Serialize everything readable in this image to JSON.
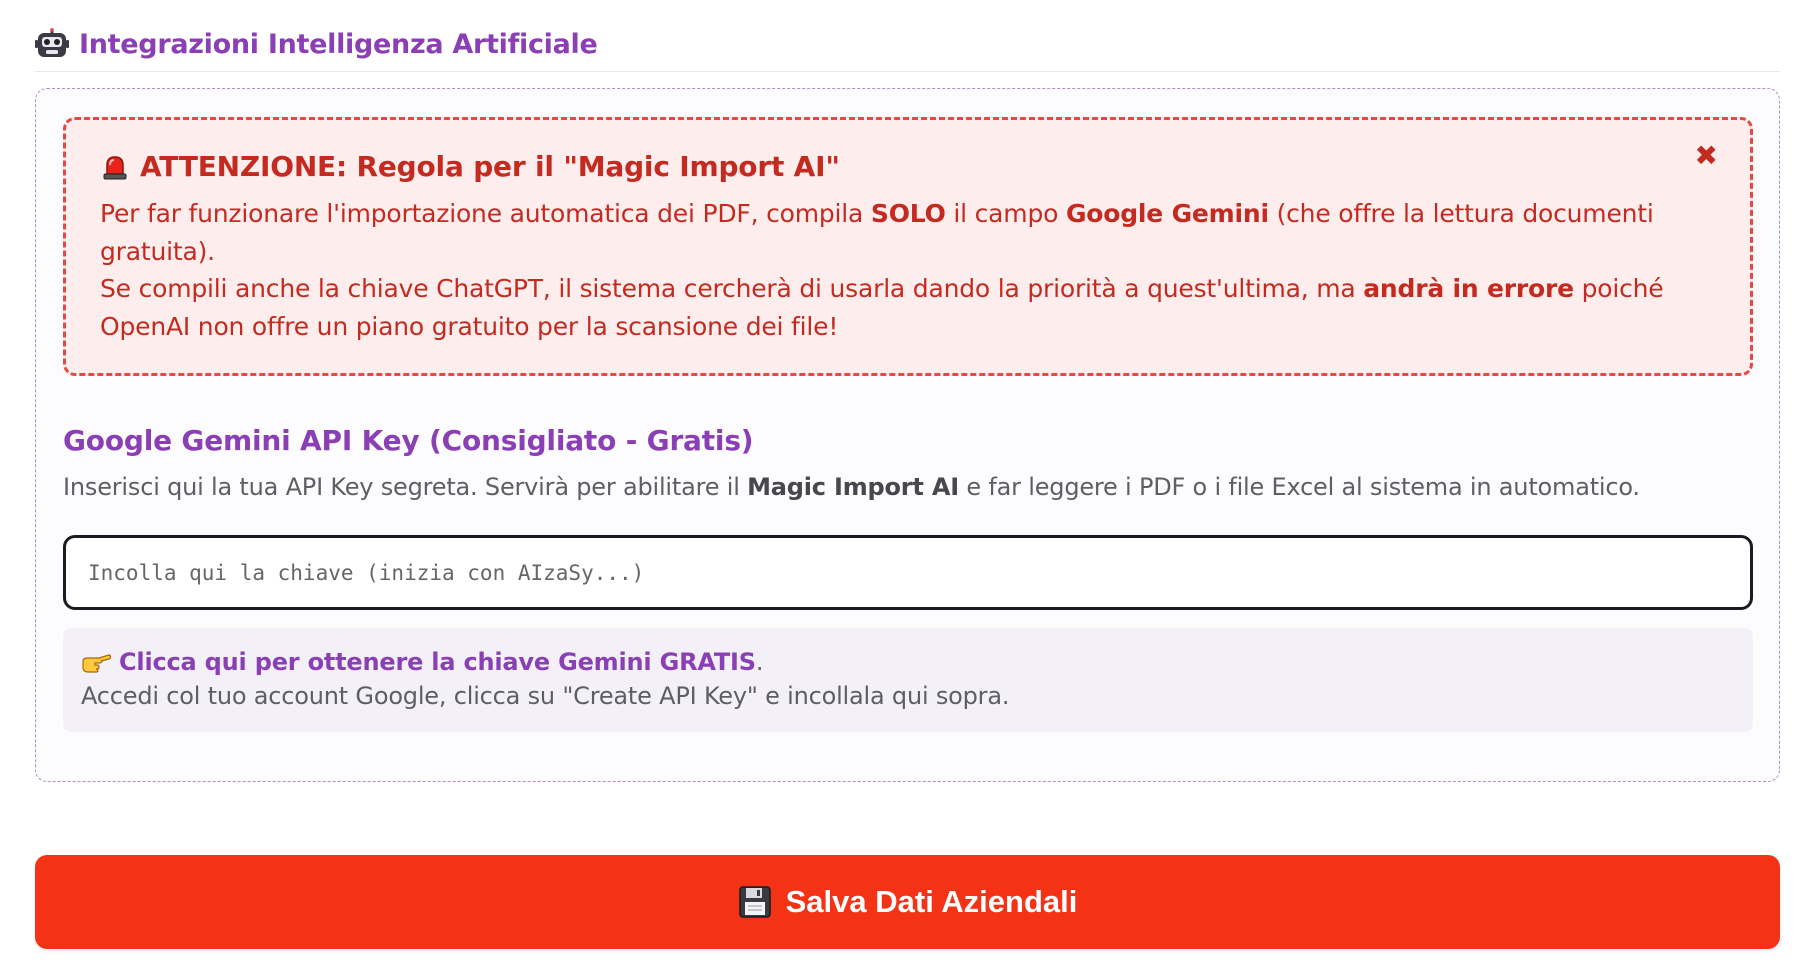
{
  "section": {
    "title": "Integrazioni Intelligenza Artificiale",
    "icon": "robot-icon"
  },
  "alert": {
    "icon": "siren-icon",
    "title": "ATTENZIONE: Regola per il \"Magic Import AI\"",
    "close_symbol": "✖",
    "line1_part1": "Per far funzionare l'importazione automatica dei PDF, compila ",
    "line1_bold1": "SOLO",
    "line1_part2": " il campo ",
    "line1_bold2": "Google Gemini",
    "line1_part3": " (che offre la lettura documenti gratuita).",
    "line2_part1": "Se compili anche la chiave ChatGPT, il sistema cercherà di usarla dando la priorità a quest'ultima, ma ",
    "line2_bold": "andrà in errore",
    "line2_part2": " poiché OpenAI non offre un piano gratuito per la scansione dei file!",
    "color": "#c42a20",
    "background": "#fdeeed"
  },
  "gemini": {
    "label": "Google Gemini API Key (Consigliato - Gratis)",
    "help_part1": "Inserisci qui la tua API Key segreta. Servirà per abilitare il ",
    "help_bold": "Magic Import AI",
    "help_part2": " e far leggere i PDF o i file Excel al sistema in automatico.",
    "input_value": "",
    "input_placeholder": "Incolla qui la chiave (inizia con AIzaSy...)",
    "link_icon": "pointing-hand-icon",
    "link_text": "Clicca qui per ottenere la chiave Gemini GRATIS",
    "link_suffix": ".",
    "instructions": "Accedi col tuo account Google, clicca su \"Create API Key\" e incollala qui sopra."
  },
  "save_button": {
    "icon": "floppy-disk-icon",
    "label": "Salva Dati Aziendali",
    "color": "#f43316"
  },
  "accent_color": "#8a3fb5"
}
